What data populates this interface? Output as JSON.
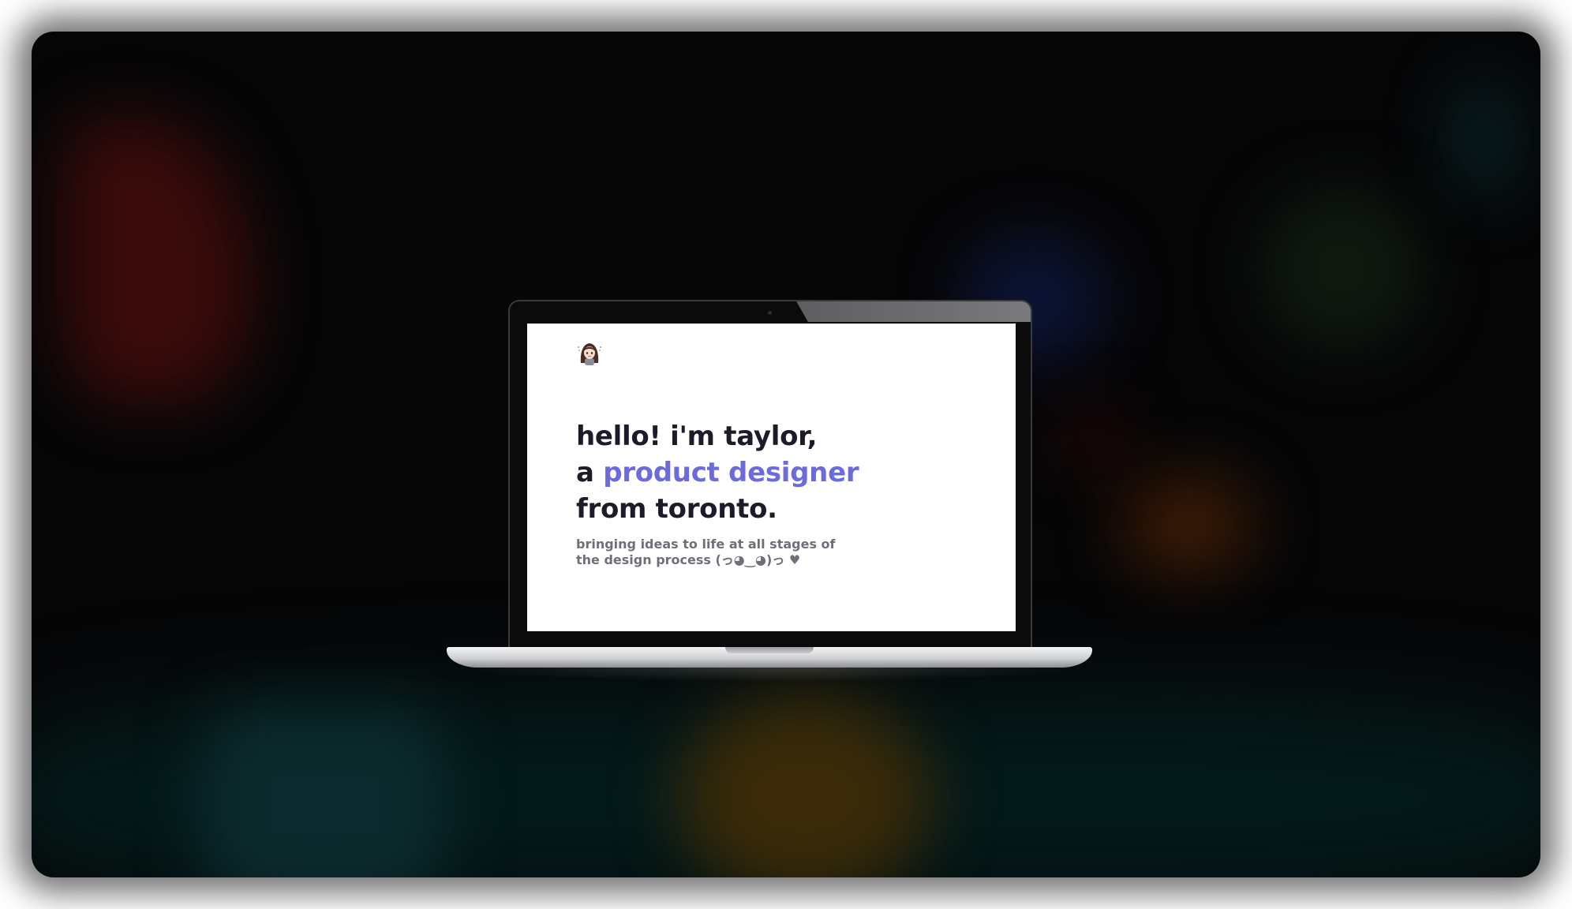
{
  "hero": {
    "line1": "hello! i'm taylor,",
    "line2_prefix": "a ",
    "line2_highlight": "product designer",
    "line3": "from toronto.",
    "subtitle": "bringing ideas to life at all stages of the design process (っ◕‿◕)っ ♥"
  },
  "avatar": {
    "icon": "girl-avatar-icon"
  },
  "colors": {
    "accent": "#6b6bdb",
    "heading": "#1b1b2a",
    "subtitle": "#6f6f7a",
    "backdrop": "#060607"
  }
}
